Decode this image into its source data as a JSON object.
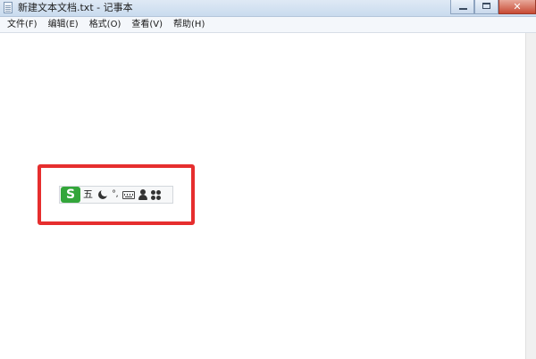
{
  "window": {
    "title": "新建文本文档.txt - 记事本",
    "close_glyph": "✕"
  },
  "menu": {
    "items": [
      "文件(F)",
      "编辑(E)",
      "格式(O)",
      "查看(V)",
      "帮助(H)"
    ]
  },
  "ime_toolbar": {
    "logo_letter": "S",
    "mode_label": "五",
    "punctuation_label": "°,",
    "icons": [
      "sogou-logo-icon",
      "moon-icon",
      "punctuation-icon",
      "keyboard-icon",
      "user-icon",
      "apps-icon"
    ],
    "logo_color": "#33a63a"
  },
  "highlight": {
    "color": "#e62e2e"
  }
}
